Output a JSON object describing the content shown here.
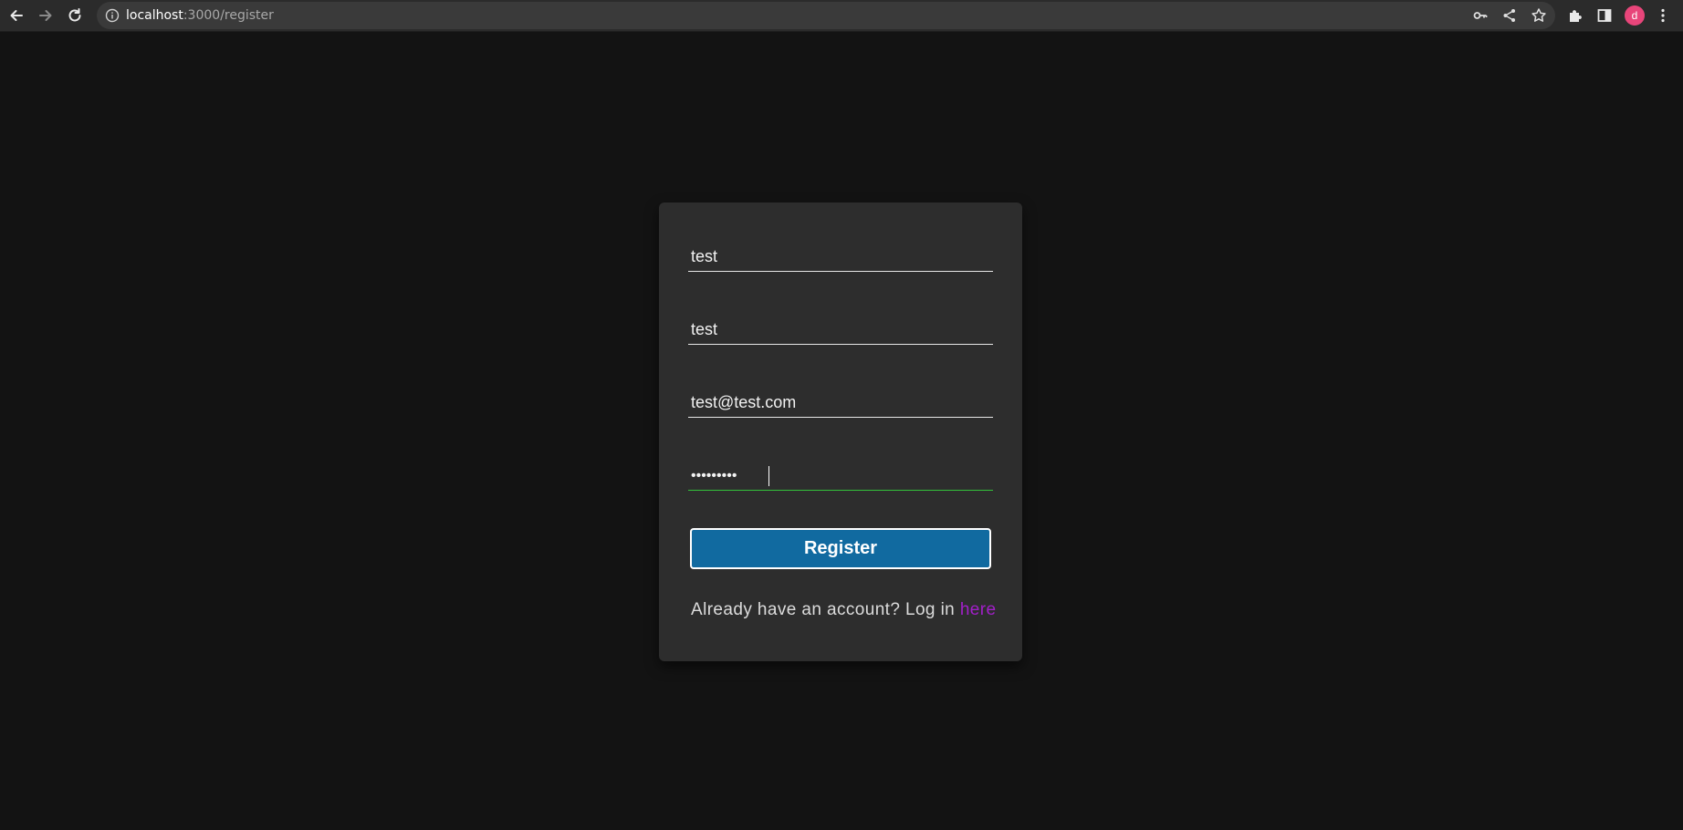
{
  "browser": {
    "url_host": "localhost",
    "url_path": ":3000/register",
    "profile_initial": "d",
    "icons": {
      "back": "arrow-left-icon",
      "forward": "arrow-right-icon",
      "reload": "reload-icon",
      "site_info": "info-icon",
      "password": "key-icon",
      "share": "share-icon",
      "bookmark": "star-icon",
      "extensions": "puzzle-icon",
      "side_panel": "side-panel-icon",
      "menu": "kebab-menu-icon"
    },
    "colors": {
      "toolbar": "#2b2b2b",
      "omnibox": "#3a3a3a",
      "avatar": "#e8457a"
    }
  },
  "form": {
    "first_name_value": "test",
    "last_name_value": "test",
    "email_value": "test@test.com",
    "password_value": "passwords",
    "register_label": "Register",
    "login_prompt": "Already have an account? Log in ",
    "login_link": "here",
    "colors": {
      "page_bg": "#131313",
      "card_bg": "#2d2d2d",
      "button_bg": "#116aa0",
      "focus_underline": "#33c23a",
      "link": "#a21fc9"
    }
  }
}
